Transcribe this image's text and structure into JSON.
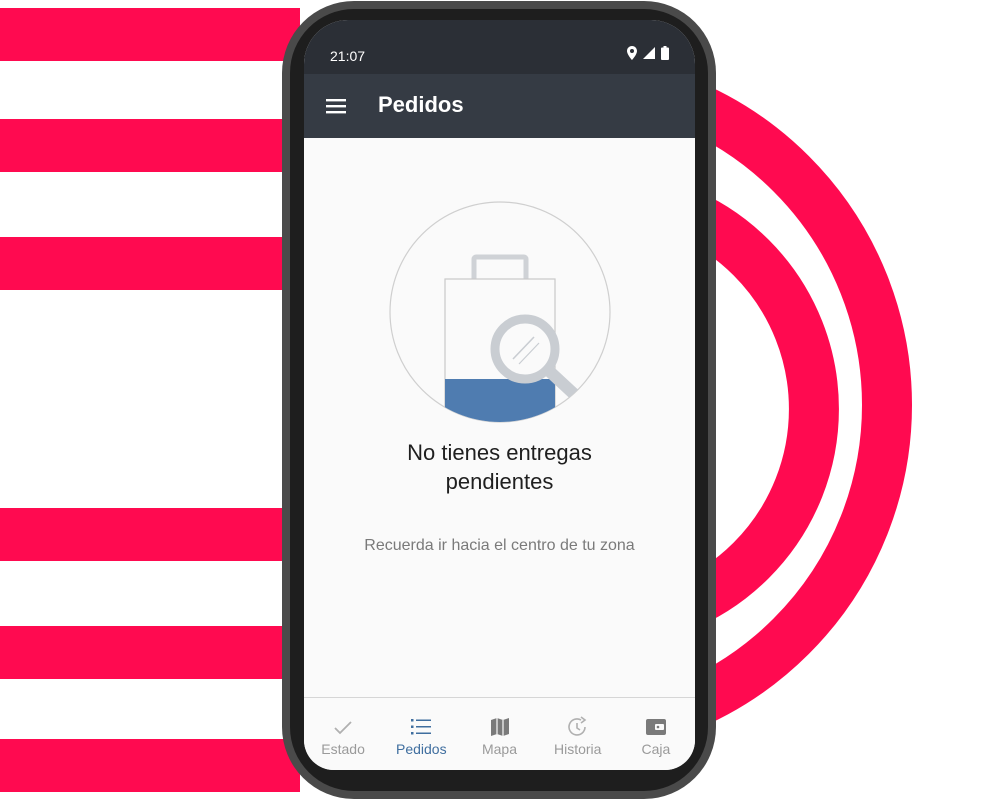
{
  "status_bar": {
    "time": "21:07",
    "icons": [
      "location-icon",
      "signal-icon",
      "battery-icon"
    ]
  },
  "app_bar": {
    "title": "Pedidos",
    "menu_icon": "hamburger-menu-icon"
  },
  "empty_state": {
    "illustration": "shopping-bag-search-icon",
    "title": "No tienes entregas pendientes",
    "subtitle": "Recuerda ir hacia el centro de tu zona"
  },
  "bottom_nav": {
    "items": [
      {
        "label": "Estado",
        "icon": "check-icon",
        "active": false
      },
      {
        "label": "Pedidos",
        "icon": "list-icon",
        "active": true
      },
      {
        "label": "Mapa",
        "icon": "map-icon",
        "active": false
      },
      {
        "label": "Historia",
        "icon": "history-icon",
        "active": false
      },
      {
        "label": "Caja",
        "icon": "wallet-icon",
        "active": false
      }
    ]
  },
  "colors": {
    "background_accent": "#ff0a50",
    "app_bar": "#353b44",
    "status_bar": "#2b2f36",
    "active_nav": "#3f6e9f",
    "inactive_nav": "#9a9a9a",
    "illustration_fill": "#4f7cb0"
  }
}
